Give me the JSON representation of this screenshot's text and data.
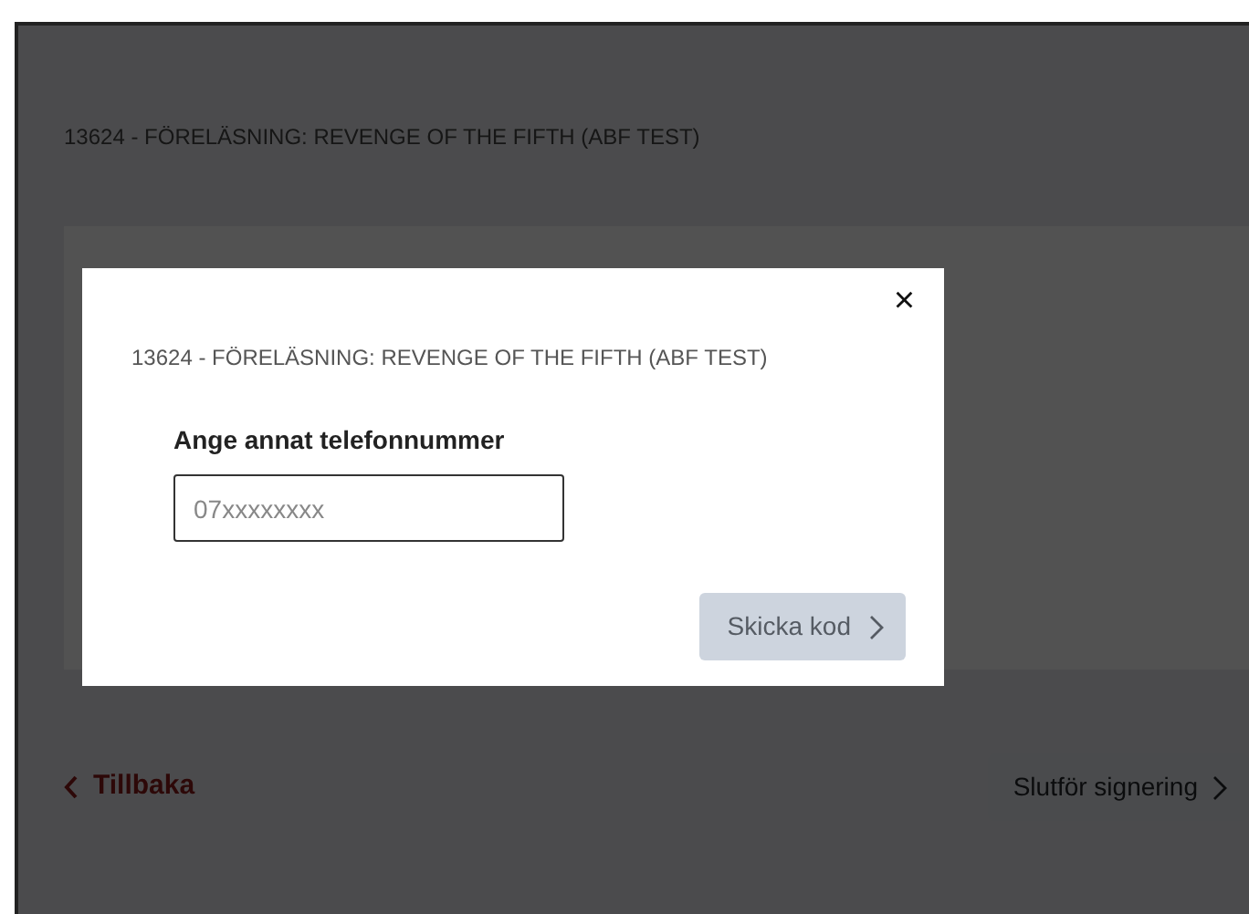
{
  "page": {
    "title": "13624 - FÖRELÄSNING: REVENGE OF THE FIFTH (ABF TEST)",
    "back_link": {
      "label": "Tillbaka"
    },
    "finish_button": {
      "label": "Slutför signering",
      "disabled": true
    }
  },
  "modal": {
    "title": "13624 - FÖRELÄSNING: REVENGE OF THE FIFTH (ABF TEST)",
    "close": "×",
    "field_label": "Ange annat telefonnummer",
    "phone_field": {
      "placeholder": "07xxxxxxxx"
    },
    "send_button": {
      "label": "Skicka kod",
      "disabled": true
    }
  }
}
